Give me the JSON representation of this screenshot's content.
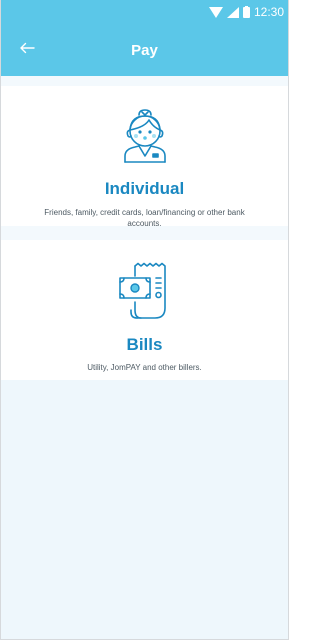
{
  "status_bar": {
    "time": "12:30",
    "icons": [
      "wifi-icon",
      "signal-icon",
      "battery-icon"
    ]
  },
  "app_bar": {
    "title": "Pay",
    "back_icon": "arrow-left-icon",
    "color": "#5bc7e8"
  },
  "options": [
    {
      "icon": "person-icon",
      "title": "Individual",
      "description": "Friends, family, credit cards, loan/financing or other bank accounts."
    },
    {
      "icon": "bill-icon",
      "title": "Bills",
      "description": "Utility, JomPAY and other billers."
    }
  ],
  "colors": {
    "accent": "#1a88c1",
    "header": "#5bc7e8",
    "background": "#eef7fc"
  }
}
